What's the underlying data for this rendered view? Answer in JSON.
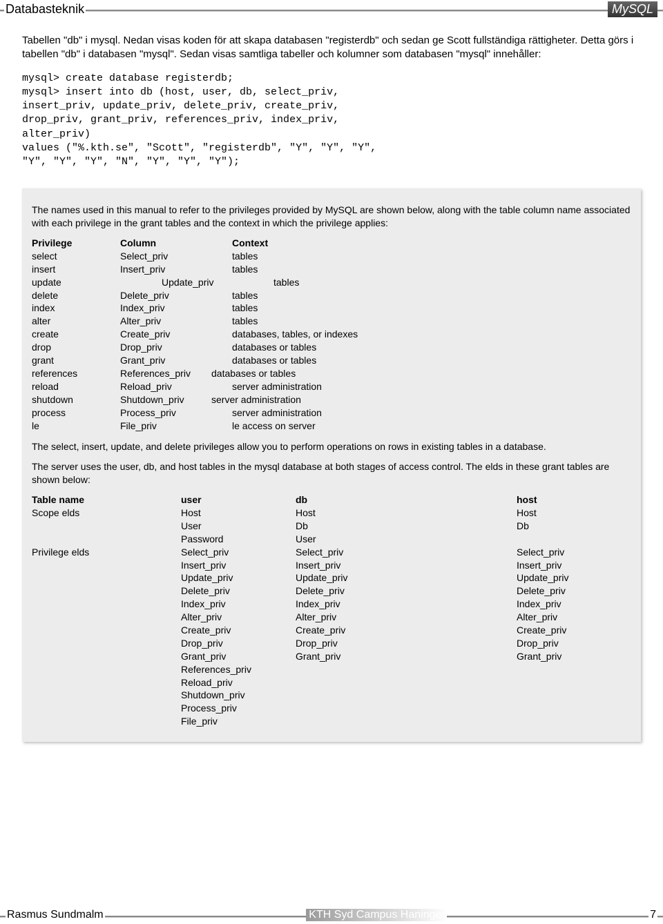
{
  "header": {
    "left": "Databasteknik",
    "right": "MySQL"
  },
  "intro": "Tabellen \"db\" i mysql. Nedan visas koden för att skapa databasen \"registerdb\" och sedan ge Scott fullständiga rättigheter. Detta görs i tabellen \"db\" i databasen \"mysql\". Sedan visas samtliga tabeller och kolumner som databasen \"mysql\" innehåller:",
  "code": "mysql> create database registerdb;\nmysql> insert into db (host, user, db, select_priv,\ninsert_priv, update_priv, delete_priv, create_priv,\ndrop_priv, grant_priv, references_priv, index_priv,\nalter_priv)\nvalues (\"%.kth.se\", \"Scott\", \"registerdb\", \"Y\", \"Y\", \"Y\",\n\"Y\", \"Y\", \"Y\", \"N\", \"Y\", \"Y\", \"Y\");",
  "box": {
    "para1": "The names used in this manual to refer to the privileges provided by MySQL are shown below, along with the table column name associated with each privilege in the grant tables and the context in which the privilege applies:",
    "t1": {
      "head": {
        "c1": "Privilege",
        "c2": "Column",
        "c3": "Context"
      },
      "rows": [
        {
          "c1": "select",
          "c2": "Select_priv",
          "c3": "tables"
        },
        {
          "c1": "insert",
          "c2": "Insert_priv",
          "c3": "tables"
        },
        {
          "c1": "update",
          "c2": "Update_priv",
          "c3": "tables"
        },
        {
          "c1": "delete",
          "c2": "Delete_priv",
          "c3": "tables"
        },
        {
          "c1": "index",
          "c2": "Index_priv",
          "c3": "tables"
        },
        {
          "c1": "alter",
          "c2": "Alter_priv",
          "c3": "tables"
        },
        {
          "c1": "create",
          "c2": "Create_priv",
          "c3": "databases, tables, or indexes"
        },
        {
          "c1": "drop",
          "c2": "Drop_priv",
          "c3": "databases or tables"
        },
        {
          "c1": "grant",
          "c2": "Grant_priv",
          "c3": "databases or tables"
        },
        {
          "c1": "references",
          "c2": "References_priv",
          "c3": "databases or tables"
        },
        {
          "c1": "reload",
          "c2": "Reload_priv",
          "c3": "server administration"
        },
        {
          "c1": "shutdown",
          "c2": "Shutdown_priv",
          "c3": "server administration"
        },
        {
          "c1": "process",
          "c2": "Process_priv",
          "c3": "server administration"
        },
        {
          "c1": "le",
          "c2": "File_priv",
          "c3": "le access on server"
        }
      ]
    },
    "para2": "The select, insert, update, and delete privileges allow you to perform operations on rows in existing tables in a database.",
    "para3": "The server uses the user, db, and host tables in the mysql database at both stages of access control. The elds in these grant tables are shown below:",
    "t2": {
      "head": {
        "c1": "Table name",
        "c2": "user",
        "c3": "db",
        "c4": "host"
      },
      "rows": [
        {
          "c1": "Scope elds",
          "c2": "Host",
          "c3": "Host",
          "c4": "Host"
        },
        {
          "c1": "",
          "c2": "User",
          "c3": "Db",
          "c4": "Db"
        },
        {
          "c1": "",
          "c2": "Password",
          "c3": "User",
          "c4": ""
        },
        {
          "c1": "Privilege elds",
          "c2": "Select_priv",
          "c3": "Select_priv",
          "c4": "Select_priv"
        },
        {
          "c1": "",
          "c2": "Insert_priv",
          "c3": "Insert_priv",
          "c4": "Insert_priv"
        },
        {
          "c1": "",
          "c2": "Update_priv",
          "c3": "Update_priv",
          "c4": "Update_priv"
        },
        {
          "c1": "",
          "c2": "Delete_priv",
          "c3": "Delete_priv",
          "c4": "Delete_priv"
        },
        {
          "c1": "",
          "c2": "Index_priv",
          "c3": "Index_priv",
          "c4": "Index_priv"
        },
        {
          "c1": "",
          "c2": "Alter_priv",
          "c3": "Alter_priv",
          "c4": "Alter_priv"
        },
        {
          "c1": "",
          "c2": "Create_priv",
          "c3": "Create_priv",
          "c4": "Create_priv"
        },
        {
          "c1": "",
          "c2": "Drop_priv",
          "c3": "Drop_priv",
          "c4": "Drop_priv"
        },
        {
          "c1": "",
          "c2": "Grant_priv",
          "c3": "Grant_priv",
          "c4": "Grant_priv"
        },
        {
          "c1": "",
          "c2": "References_priv",
          "c3": "",
          "c4": ""
        },
        {
          "c1": "",
          "c2": "Reload_priv",
          "c3": "",
          "c4": ""
        },
        {
          "c1": "",
          "c2": "Shutdown_priv",
          "c3": "",
          "c4": ""
        },
        {
          "c1": "",
          "c2": "Process_priv",
          "c3": "",
          "c4": ""
        },
        {
          "c1": "",
          "c2": "File_priv",
          "c3": "",
          "c4": ""
        }
      ]
    }
  },
  "footer": {
    "left": "Rasmus Sundmalm",
    "center": "KTH Syd Campus Haninge",
    "right": "7"
  }
}
